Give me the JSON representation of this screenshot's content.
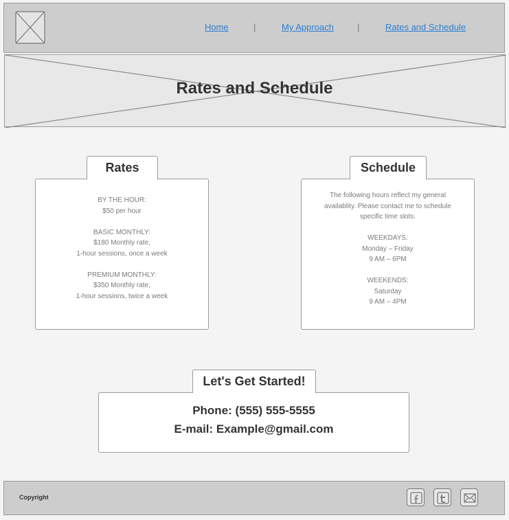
{
  "nav": {
    "home": "Home",
    "approach": "My Approach",
    "rates": "Rates and Schedule",
    "sep": "|"
  },
  "hero": {
    "title": "Rates and Schedule"
  },
  "rates": {
    "tab": "Rates",
    "hour_title": "BY THE HOUR:",
    "hour_price": "$50 per hour",
    "basic_title": "BASIC MONTHLY:",
    "basic_rate": "$180 Monthly rate,",
    "basic_detail": "1-hour sessions, once a week",
    "premium_title": "PREMIUM MONTHLY:",
    "premium_rate": "$350 Monthly rate,",
    "premium_detail": "1-hour sessions, twice a week"
  },
  "schedule": {
    "tab": "Schedule",
    "intro_1": "The following hours reflect my general",
    "intro_2": "availablity. Please contact me to schedule",
    "intro_3": "specific time slots.",
    "weekdays_title": "WEEKDAYS:",
    "weekdays_days": "Monday – Friday",
    "weekdays_hours": "9 AM – 6PM",
    "weekends_title": "WEEKENDS:",
    "weekends_days": "Saturday",
    "weekends_hours": "9 AM – 4PM"
  },
  "contact": {
    "tab": "Let's Get Started!",
    "phone": "Phone: (555) 555-5555",
    "email": "E-mail: Example@gmail.com"
  },
  "footer": {
    "copyright": "Copyright",
    "icons": [
      "facebook-icon",
      "twitter-icon",
      "mail-icon"
    ]
  }
}
